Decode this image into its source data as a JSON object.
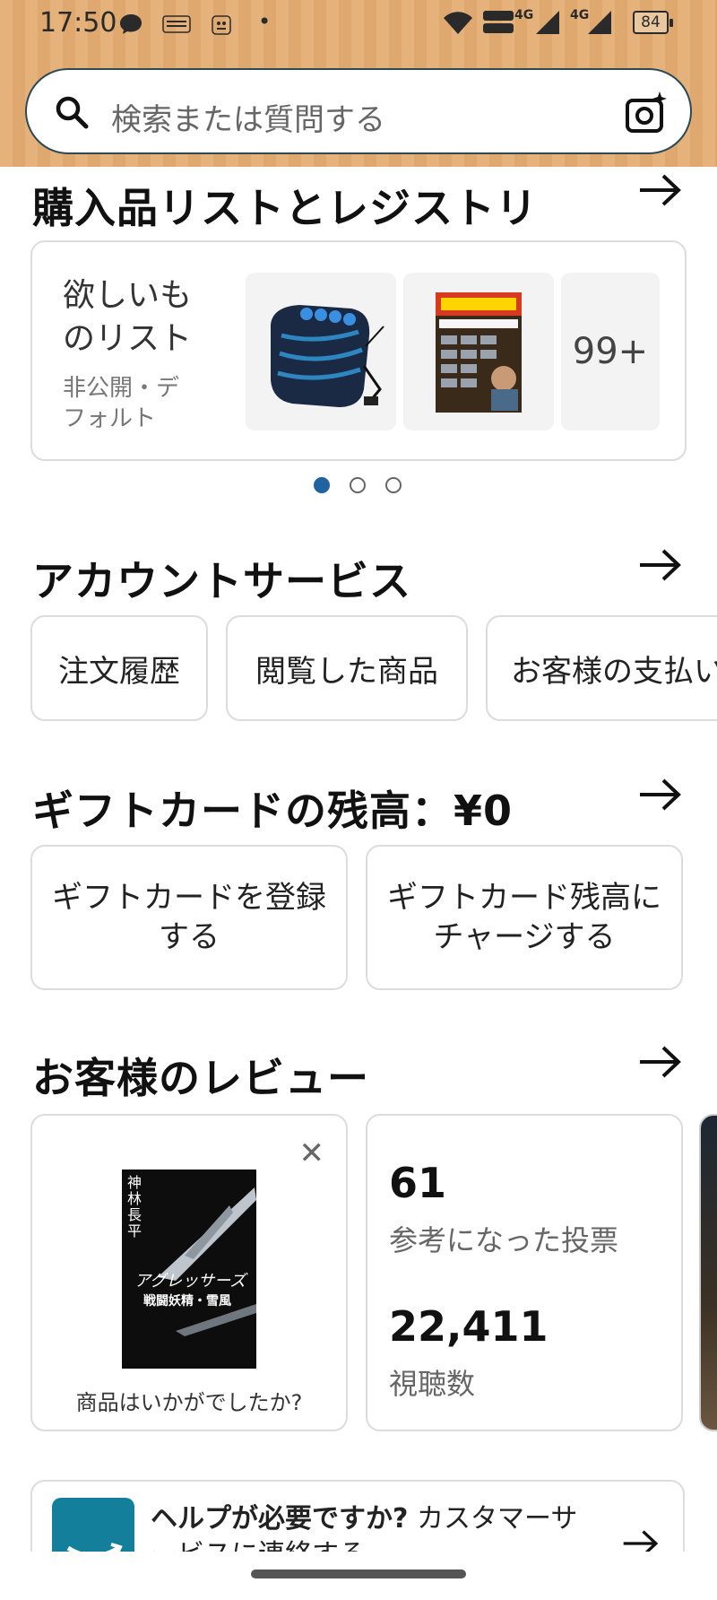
{
  "status_bar": {
    "time": "17:50",
    "app_icons": [
      "chat-bubble-icon",
      "temu-icon",
      "ninja-icon"
    ],
    "dot": "•",
    "network_labels": [
      "4G",
      "4G"
    ],
    "battery": "84"
  },
  "search": {
    "placeholder": "検索または質問する"
  },
  "lists_section": {
    "title": "購入品リストとレジストリ",
    "wishlist": {
      "title": "欲しいものリスト",
      "subtitle": "非公開・デフォルト",
      "more_count": "99+"
    },
    "pagination": {
      "total": 3,
      "active": 0
    }
  },
  "account_section": {
    "title": "アカウントサービス",
    "pills": [
      "注文履歴",
      "閲覧した商品",
      "お客様の支払い"
    ]
  },
  "gift_section": {
    "title": "ギフトカードの残高：¥0",
    "buttons": [
      "ギフトカードを登録する",
      "ギフトカード残高にチャージする"
    ]
  },
  "review_section": {
    "title": "お客様のレビュー",
    "prompt": "商品はいかがでしたか?",
    "book_title_vertical": "神林長平",
    "book_title": "アグレッサーズ",
    "book_subtitle": "戦闘妖精・雪風",
    "helpful_votes": "61",
    "helpful_votes_label": "参考になった投票",
    "views": "22,411",
    "views_label": "視聴数"
  },
  "help_card": {
    "bold": "ヘルプが必要ですか?",
    "text": " カスタマーサービスに連絡する"
  },
  "colors": {
    "header_bg": "#e4b27a",
    "active_dot": "#2162a1",
    "help_logo": "#137f9a"
  }
}
